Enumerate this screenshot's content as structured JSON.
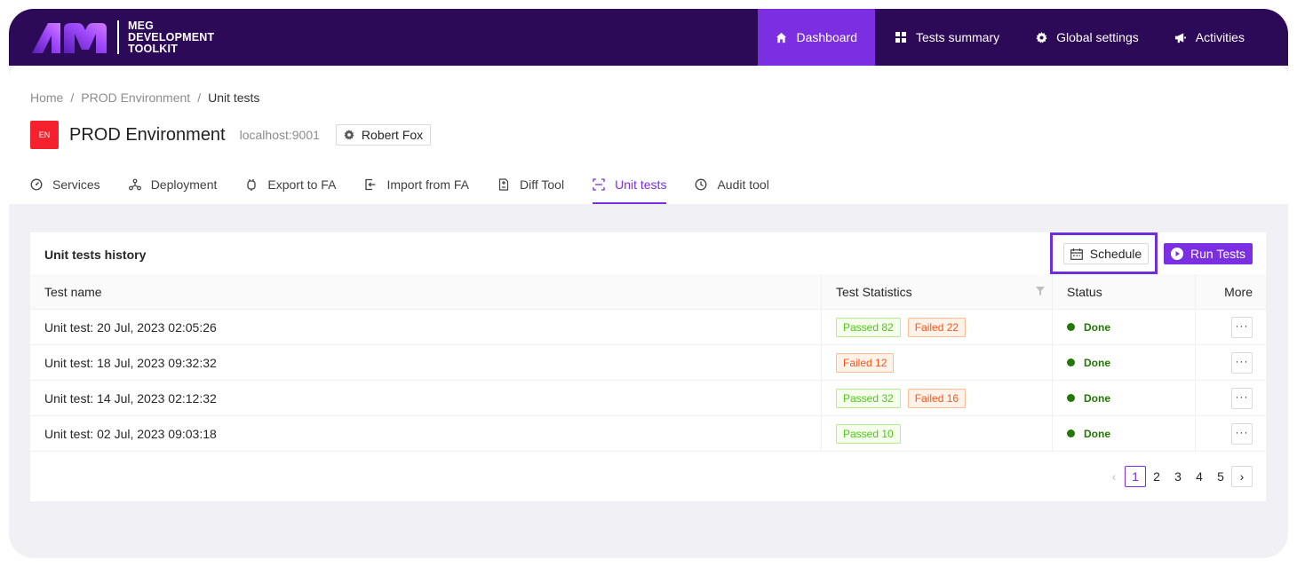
{
  "brand": {
    "line1": "MEG",
    "line2": "DEVELOPMENT",
    "line3": "TOOLKIT",
    "accent": "#7b2fe0",
    "topbar_bg": "#2c0a57"
  },
  "nav": [
    {
      "label": "Dashboard",
      "icon": "home-icon",
      "active": true
    },
    {
      "label": "Tests summary",
      "icon": "grid-icon"
    },
    {
      "label": "Global settings",
      "icon": "gear-icon"
    },
    {
      "label": "Activities",
      "icon": "megaphone-icon"
    }
  ],
  "breadcrumb": {
    "home": "Home",
    "env": "PROD Environment",
    "current": "Unit tests",
    "sep": "/"
  },
  "environment": {
    "badge": "EN",
    "title": "PROD Environment",
    "host": "localhost:9001",
    "user": "Robert Fox"
  },
  "tabs": [
    {
      "label": "Services",
      "icon": "dashboard-icon"
    },
    {
      "label": "Deployment",
      "icon": "deployment-icon"
    },
    {
      "label": "Export to FA",
      "icon": "export-icon"
    },
    {
      "label": "Import from FA",
      "icon": "import-icon"
    },
    {
      "label": "Diff Tool",
      "icon": "diff-icon"
    },
    {
      "label": "Unit tests",
      "icon": "scan-icon",
      "active": true
    },
    {
      "label": "Audit tool",
      "icon": "clock-icon"
    }
  ],
  "card": {
    "title": "Unit tests history",
    "schedule_label": "Schedule",
    "run_label": "Run Tests"
  },
  "table": {
    "headers": {
      "name": "Test name",
      "stats": "Test Statistics",
      "status": "Status",
      "more": "More"
    },
    "rows": [
      {
        "name": "Unit test: 20 Jul, 2023 02:05:26",
        "passed": "Passed  82",
        "failed": "Failed 22",
        "status": "Done"
      },
      {
        "name": "Unit test: 18 Jul, 2023 09:32:32",
        "passed": "",
        "failed": "Failed 12",
        "status": "Done"
      },
      {
        "name": "Unit test: 14 Jul, 2023 02:12:32",
        "passed": "Passed  32",
        "failed": "Failed 16",
        "status": "Done"
      },
      {
        "name": "Unit test: 02 Jul, 2023 09:03:18",
        "passed": "Passed 10",
        "failed": "",
        "status": "Done"
      }
    ],
    "more_label": "···"
  },
  "pagination": {
    "pages": [
      "1",
      "2",
      "3",
      "4",
      "5"
    ],
    "current": "1",
    "prev": "‹",
    "next": "›"
  }
}
